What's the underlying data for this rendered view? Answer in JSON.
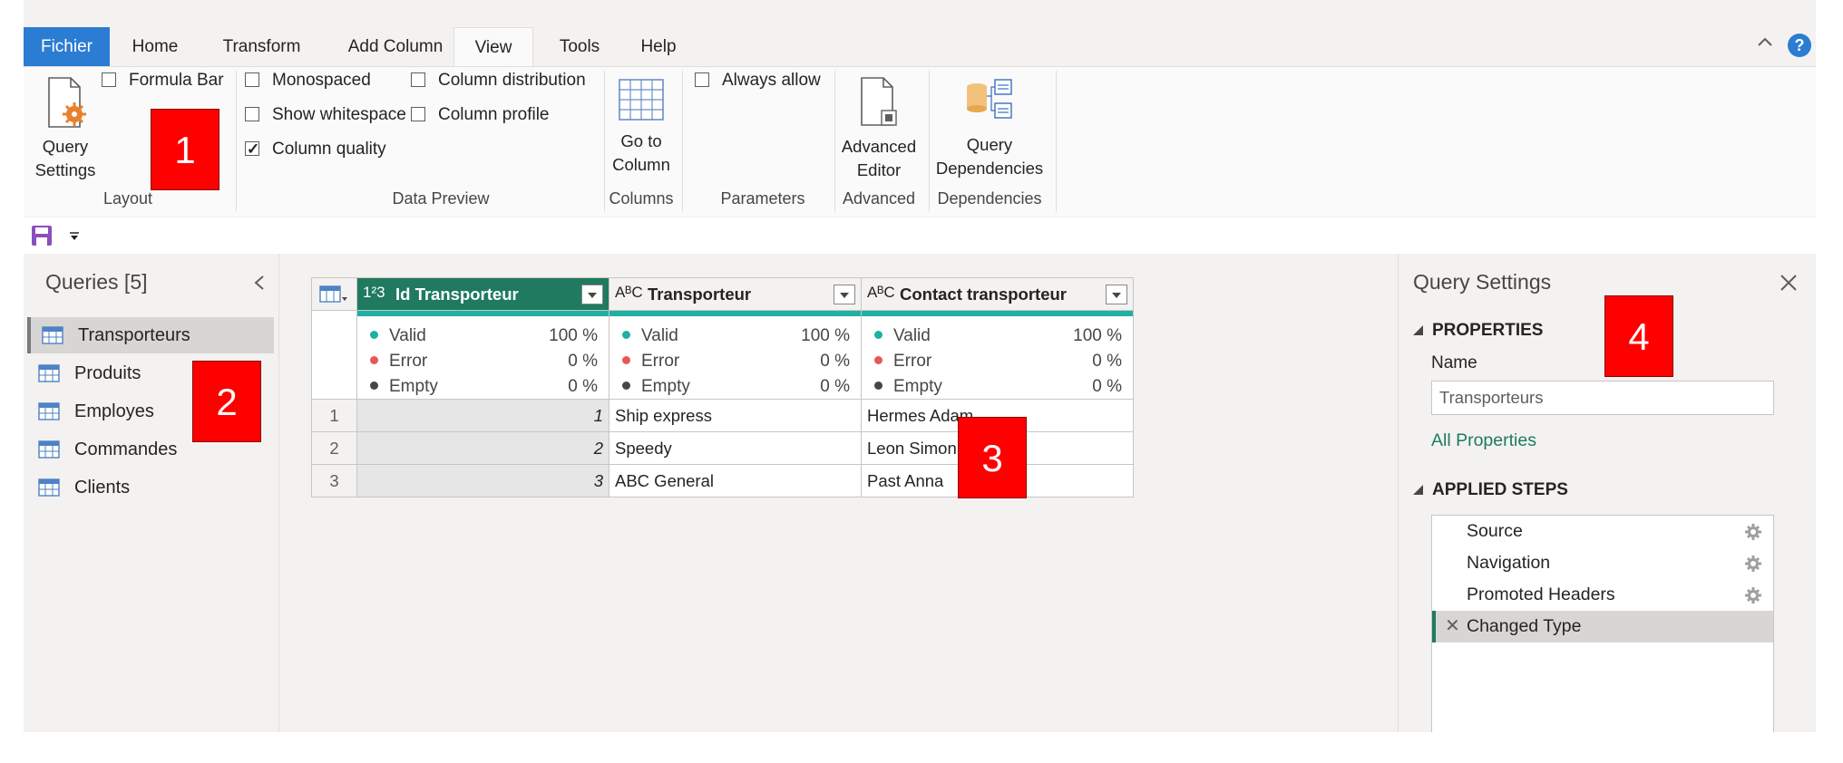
{
  "ribbon": {
    "tabs": [
      "Fichier",
      "Home",
      "Transform",
      "Add Column",
      "View",
      "Tools",
      "Help"
    ],
    "active_tab": "View",
    "layout": {
      "query_settings_line1": "Query",
      "query_settings_line2": "Settings",
      "formula_bar": "Formula Bar",
      "group_label": "Layout"
    },
    "data_preview": {
      "monospaced": "Monospaced",
      "show_whitespace": "Show whitespace",
      "column_quality": "Column quality",
      "column_distribution": "Column distribution",
      "column_profile": "Column profile",
      "group_label": "Data Preview"
    },
    "columns": {
      "go_to_line1": "Go to",
      "go_to_line2": "Column",
      "group_label": "Columns"
    },
    "parameters": {
      "always_allow": "Always allow",
      "group_label": "Parameters"
    },
    "advanced": {
      "editor_line1": "Advanced",
      "editor_line2": "Editor",
      "group_label": "Advanced"
    },
    "dependencies": {
      "query_line1": "Query",
      "query_line2": "Dependencies",
      "group_label": "Dependencies"
    },
    "help": "?"
  },
  "queries": {
    "title": "Queries [5]",
    "items": [
      "Transporteurs",
      "Produits",
      "Employes",
      "Commandes",
      "Clients"
    ],
    "selected": "Transporteurs"
  },
  "table": {
    "columns": [
      {
        "type": "1²3",
        "name": "Id Transporteur"
      },
      {
        "type": "AᴮC",
        "name": "Transporteur"
      },
      {
        "type": "AᴮC",
        "name": "Contact transporteur"
      }
    ],
    "quality_labels": [
      "Valid",
      "Error",
      "Empty"
    ],
    "quality": [
      [
        "100 %",
        "0 %",
        "0 %"
      ],
      [
        "100 %",
        "0 %",
        "0 %"
      ],
      [
        "100 %",
        "0 %",
        "0 %"
      ]
    ],
    "rows": [
      [
        "1",
        "1",
        "Ship express",
        "Hermes Adam"
      ],
      [
        "2",
        "2",
        "Speedy",
        "Leon Simon"
      ],
      [
        "3",
        "3",
        "ABC General",
        "Past Anna"
      ]
    ],
    "colors": {
      "valid": "#1fb0a2",
      "error": "#e85757",
      "empty": "#484644"
    }
  },
  "settings": {
    "title": "Query Settings",
    "properties_header": "PROPERTIES",
    "name_label": "Name",
    "name_value": "Transporteurs",
    "all_properties": "All Properties",
    "applied_steps_header": "APPLIED STEPS",
    "steps": [
      "Source",
      "Navigation",
      "Promoted Headers",
      "Changed Type"
    ]
  },
  "badges": [
    "1",
    "2",
    "3",
    "4"
  ]
}
